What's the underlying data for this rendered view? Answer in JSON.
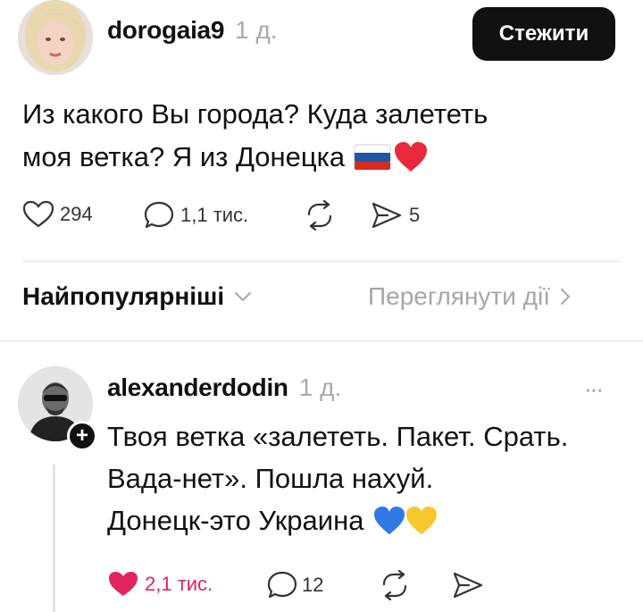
{
  "post": {
    "author": "dorogaia9",
    "time": "1 д.",
    "follow_label": "Стежити",
    "text_line1": "Из какого Вы города? Куда залететь",
    "text_line2": "моя ветка? Я из Донецка",
    "emoji_suffix": "🇷🇺❤️",
    "likes": "294",
    "comments": "1,1 тис.",
    "shares": "5"
  },
  "sort": {
    "label": "Найпопулярніші",
    "activity_link": "Переглянути дії"
  },
  "reply": {
    "author": "alexanderdodin",
    "time": "1 д.",
    "more": "···",
    "line1": "Твоя ветка «залететь. Пакет. Срать.",
    "line2": "Вада-нет». Пошла нахуй.",
    "line3": "Донецк-это Украина",
    "emoji_suffix": "💙💛",
    "likes": "2,1 тис.",
    "comments": "12"
  },
  "colors": {
    "like_active": "#e0245e",
    "muted": "#a7a7a7",
    "flag_white": "#ffffff",
    "flag_blue": "#1c57a7",
    "flag_red": "#d52b1e",
    "heart_red": "#e8283c",
    "heart_blue": "#2f7ae5",
    "heart_yellow": "#f7c92c"
  },
  "icons": [
    "heart-icon",
    "comment-icon",
    "repost-icon",
    "share-icon",
    "chevron-down-icon",
    "chevron-right-icon",
    "plus-icon",
    "more-icon"
  ]
}
